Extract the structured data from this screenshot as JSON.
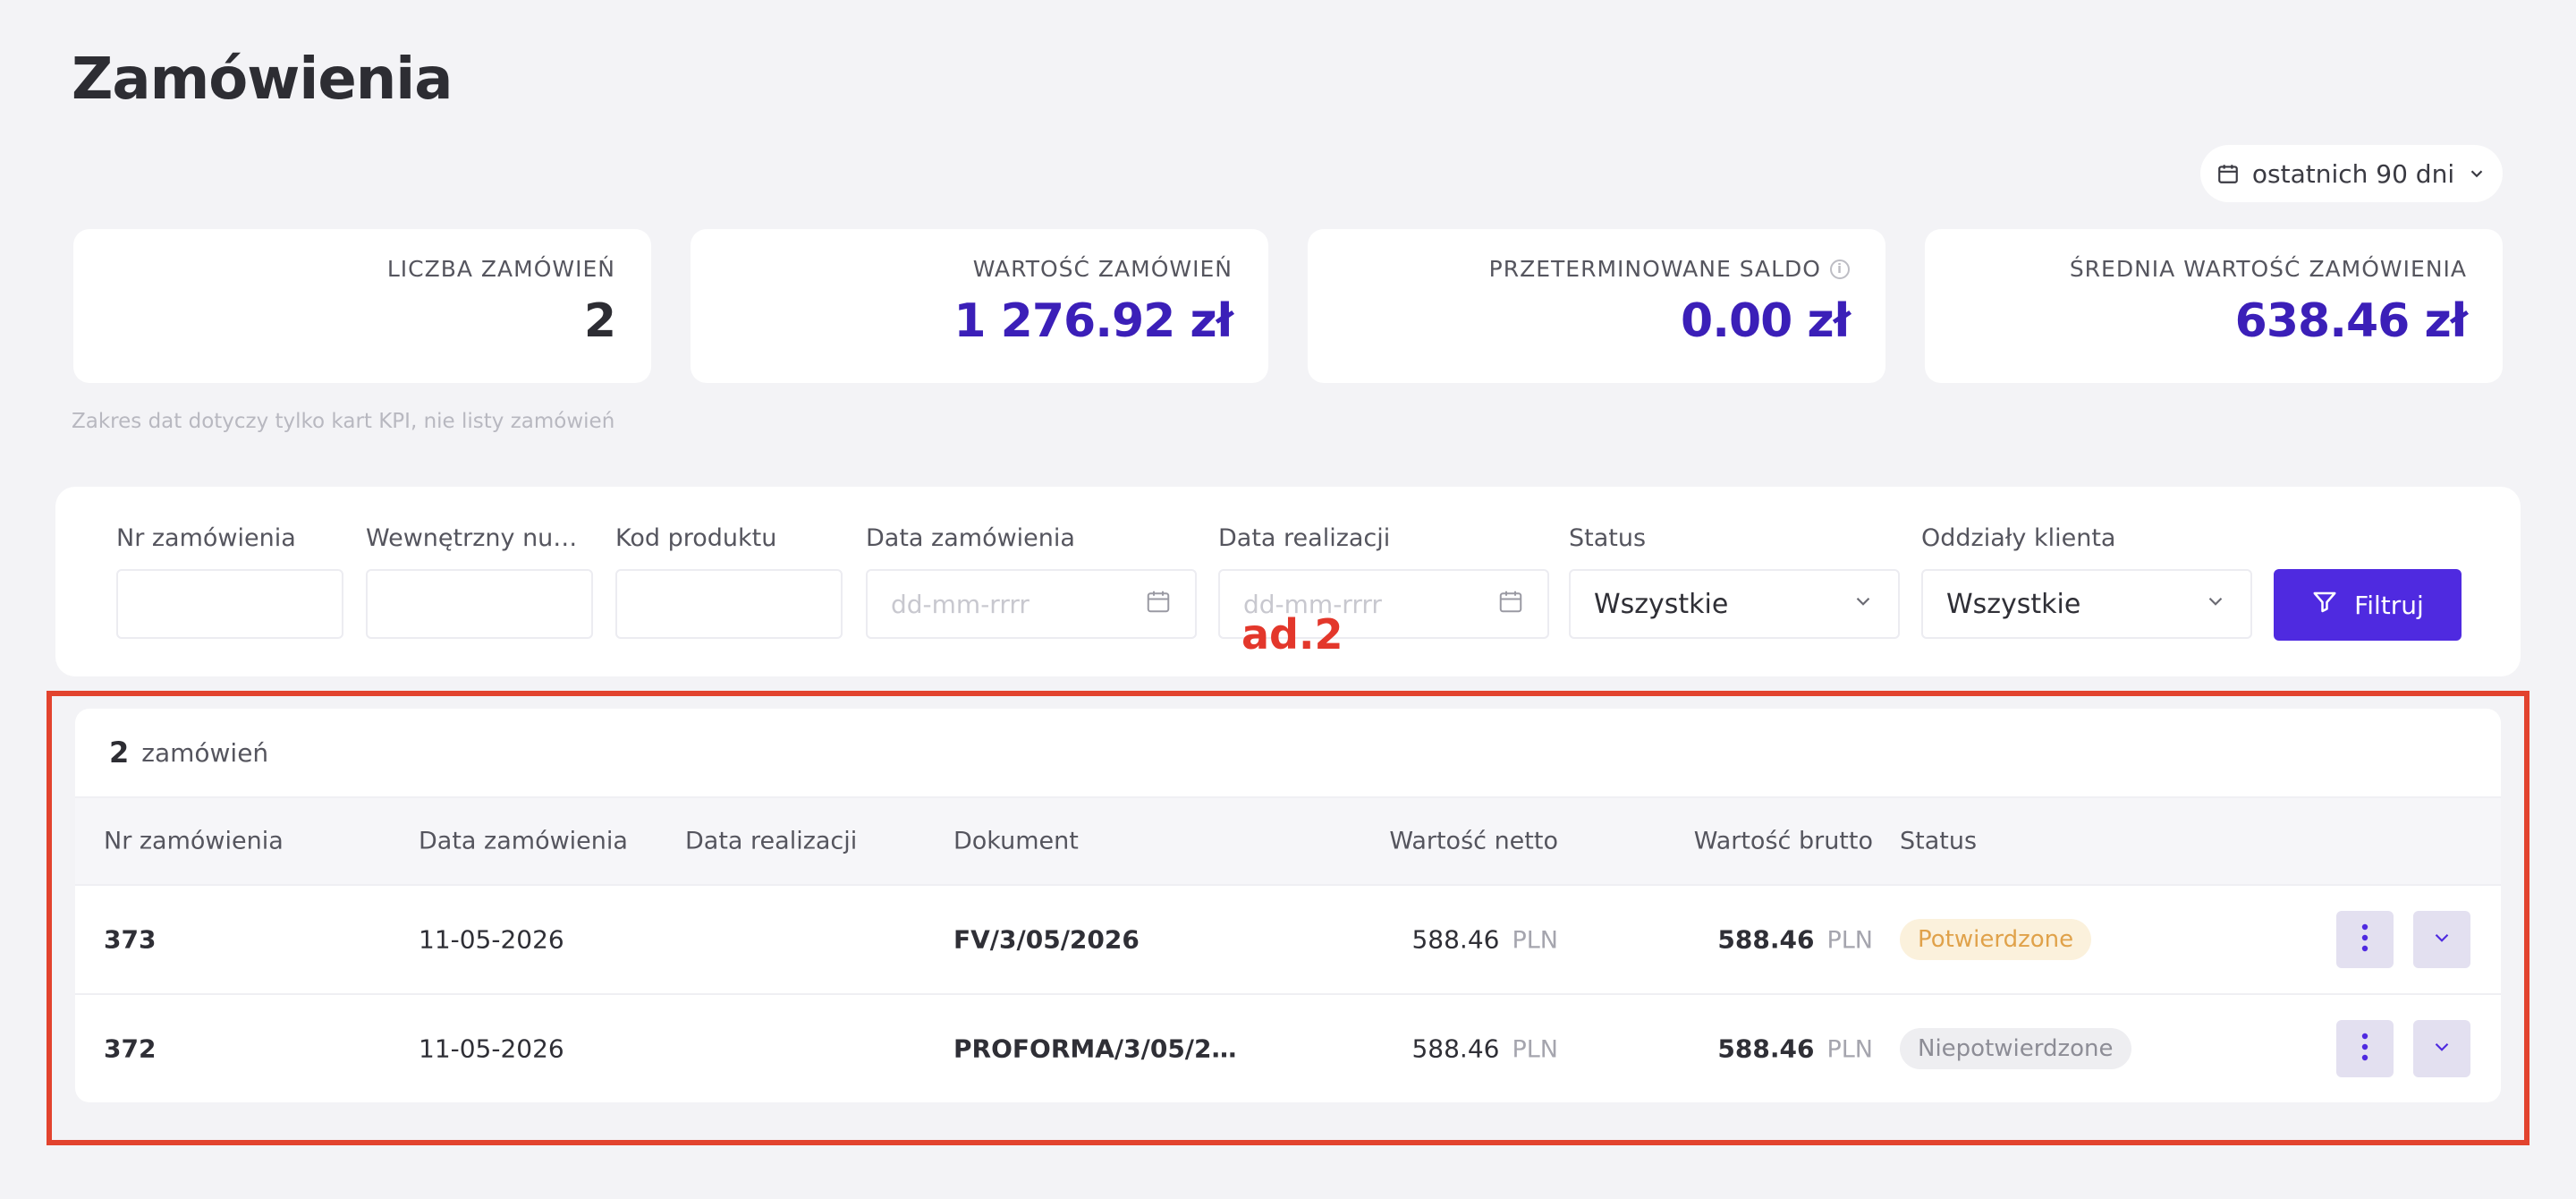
{
  "page": {
    "title": "Zamówienia"
  },
  "date_range": {
    "label": "ostatnich 90 dni",
    "icon": "calendar-icon",
    "chevron": "chevron-down-icon"
  },
  "kpis": [
    {
      "label": "LICZBA ZAMÓWIEŃ",
      "value": "2"
    },
    {
      "label": "WARTOŚĆ ZAMÓWIEŃ",
      "value": "1 276.92 zł"
    },
    {
      "label": "PRZETERMINOWANE SALDO",
      "value": "0.00 zł",
      "info_icon": "i"
    },
    {
      "label": "ŚREDNIA WARTOŚĆ ZAMÓWIENIA",
      "value": "638.46 zł"
    }
  ],
  "kpi_note": "Zakres dat dotyczy tylko kart KPI, nie listy zamówień",
  "filters": {
    "order_no": {
      "label": "Nr zamówienia",
      "value": ""
    },
    "internal_no": {
      "label": "Wewnętrzny num…",
      "value": ""
    },
    "product_code": {
      "label": "Kod produktu",
      "value": ""
    },
    "order_date": {
      "label": "Data zamówienia",
      "placeholder": "dd-mm-rrrr"
    },
    "realization_date": {
      "label": "Data realizacji",
      "placeholder": "dd-mm-rrrr"
    },
    "status": {
      "label": "Status",
      "value": "Wszystkie"
    },
    "branches": {
      "label": "Oddziały klienta",
      "value": "Wszystkie"
    },
    "submit_label": "Filtruj"
  },
  "annotation": "ad.2",
  "orders": {
    "count": "2",
    "count_label": "zamówień",
    "columns": [
      "Nr zamówienia",
      "Data zamówienia",
      "Data realizacji",
      "Dokument",
      "Wartość netto",
      "Wartość brutto",
      "Status"
    ],
    "rows": [
      {
        "nr": "373",
        "order_date": "11-05-2026",
        "realization_date": "",
        "document": "FV/3/05/2026",
        "net": "588.46",
        "net_cur": "PLN",
        "gross": "588.46",
        "gross_cur": "PLN",
        "status": "Potwierdzone"
      },
      {
        "nr": "372",
        "order_date": "11-05-2026",
        "realization_date": "",
        "document": "PROFORMA/3/05/2…",
        "net": "588.46",
        "net_cur": "PLN",
        "gross": "588.46",
        "gross_cur": "PLN",
        "status": "Niepotwierdzone"
      }
    ]
  },
  "colors": {
    "accent": "#4f2ae0",
    "kpi_value": "#3b1fb8",
    "annotation": "#e3372b",
    "badge_confirmed": "#e0a24a"
  }
}
